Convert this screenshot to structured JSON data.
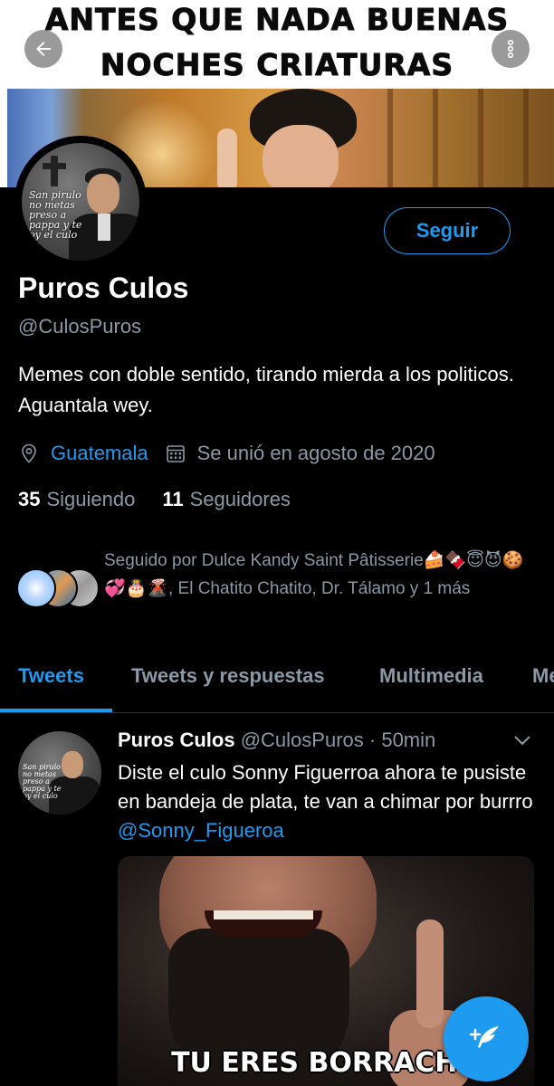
{
  "banner": {
    "line1": "ANTES QUE NADA BUENAS",
    "line2": "NOCHES CRIATURAS"
  },
  "avatar_text": [
    "San pirulo",
    "no metas",
    "preso a",
    "pappa y te",
    "oy el culo"
  ],
  "profile": {
    "follow_label": "Seguir",
    "name": "Puros Culos",
    "handle": "@CulosPuros",
    "bio": "Memes con doble sentido, tirando mierda a los politicos.  Aguantala wey.",
    "location": "Guatemala",
    "joined": "Se unió en agosto de 2020",
    "following_count": "35",
    "following_label": "Siguiendo",
    "followers_count": "11",
    "followers_label": "Seguidores",
    "followed_by": "Seguido por Dulce Kandy Saint Pâtisserie🍰🍫😇😈🍪💞🎂🌋, El Chatito Chatito, Dr. Tálamo y 1 más"
  },
  "tabs": [
    "Tweets",
    "Tweets y respuestas",
    "Multimedia",
    "Me"
  ],
  "tweet": {
    "name": "Puros Culos",
    "handle": "@CulosPuros",
    "time": "· 50min",
    "text": "Diste el culo Sonny Figuerroa ahora te pusiste en bandeja de plata, te van a chimar por burrro ",
    "mention": "@Sonny_Figueroa",
    "media_caption": "TU ERES BORRACHO"
  },
  "colors": {
    "accent": "#1d9bf0",
    "secondary_text": "#8b98a5",
    "background": "#000000"
  },
  "icons": {
    "back": "arrow-left-icon",
    "more": "more-vertical-icon",
    "location": "location-pin-icon",
    "calendar": "calendar-icon",
    "chevron": "chevron-down-icon",
    "compose": "compose-tweet-icon"
  }
}
